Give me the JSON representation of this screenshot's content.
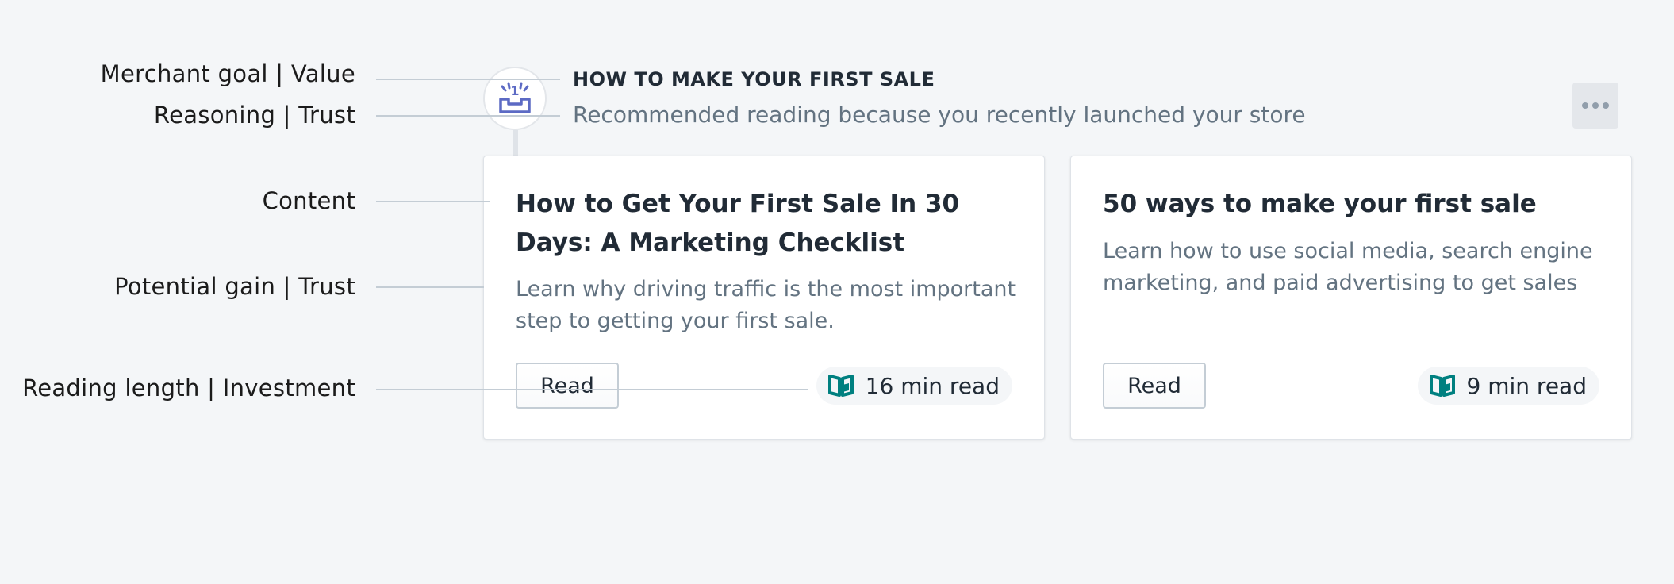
{
  "annotations": [
    {
      "label": "Merchant goal | Value"
    },
    {
      "label": "Reasoning | Trust"
    },
    {
      "label": "Content"
    },
    {
      "label": "Potential gain | Trust"
    },
    {
      "label": "Reading length | Investment"
    }
  ],
  "goal": {
    "icon": "shop-first-sale-icon",
    "icon_numeral": "1",
    "title": "HOW TO MAKE YOUR FIRST SALE",
    "reason": "Recommended reading because you recently launched your store",
    "more_icon": "horizontal-dots-icon"
  },
  "cards": [
    {
      "title": "How to Get Your First Sale In 30 Days: A Marketing Checklist",
      "description": "Learn why driving traffic is the most important step to getting your first sale.",
      "button_label": "Read",
      "read_time": "16 min read",
      "read_icon": "open-book-icon"
    },
    {
      "title": "50 ways to make your first sale",
      "description": "Learn how to use social media, search engine marketing, and paid advertising to get sales",
      "button_label": "Read",
      "read_time": "9 min read",
      "read_icon": "open-book-icon"
    }
  ],
  "colors": {
    "background": "#f4f6f8",
    "icon_accent": "#5c6ac4",
    "book_icon": "#008080",
    "annotation_line": "#c4cdd5"
  }
}
